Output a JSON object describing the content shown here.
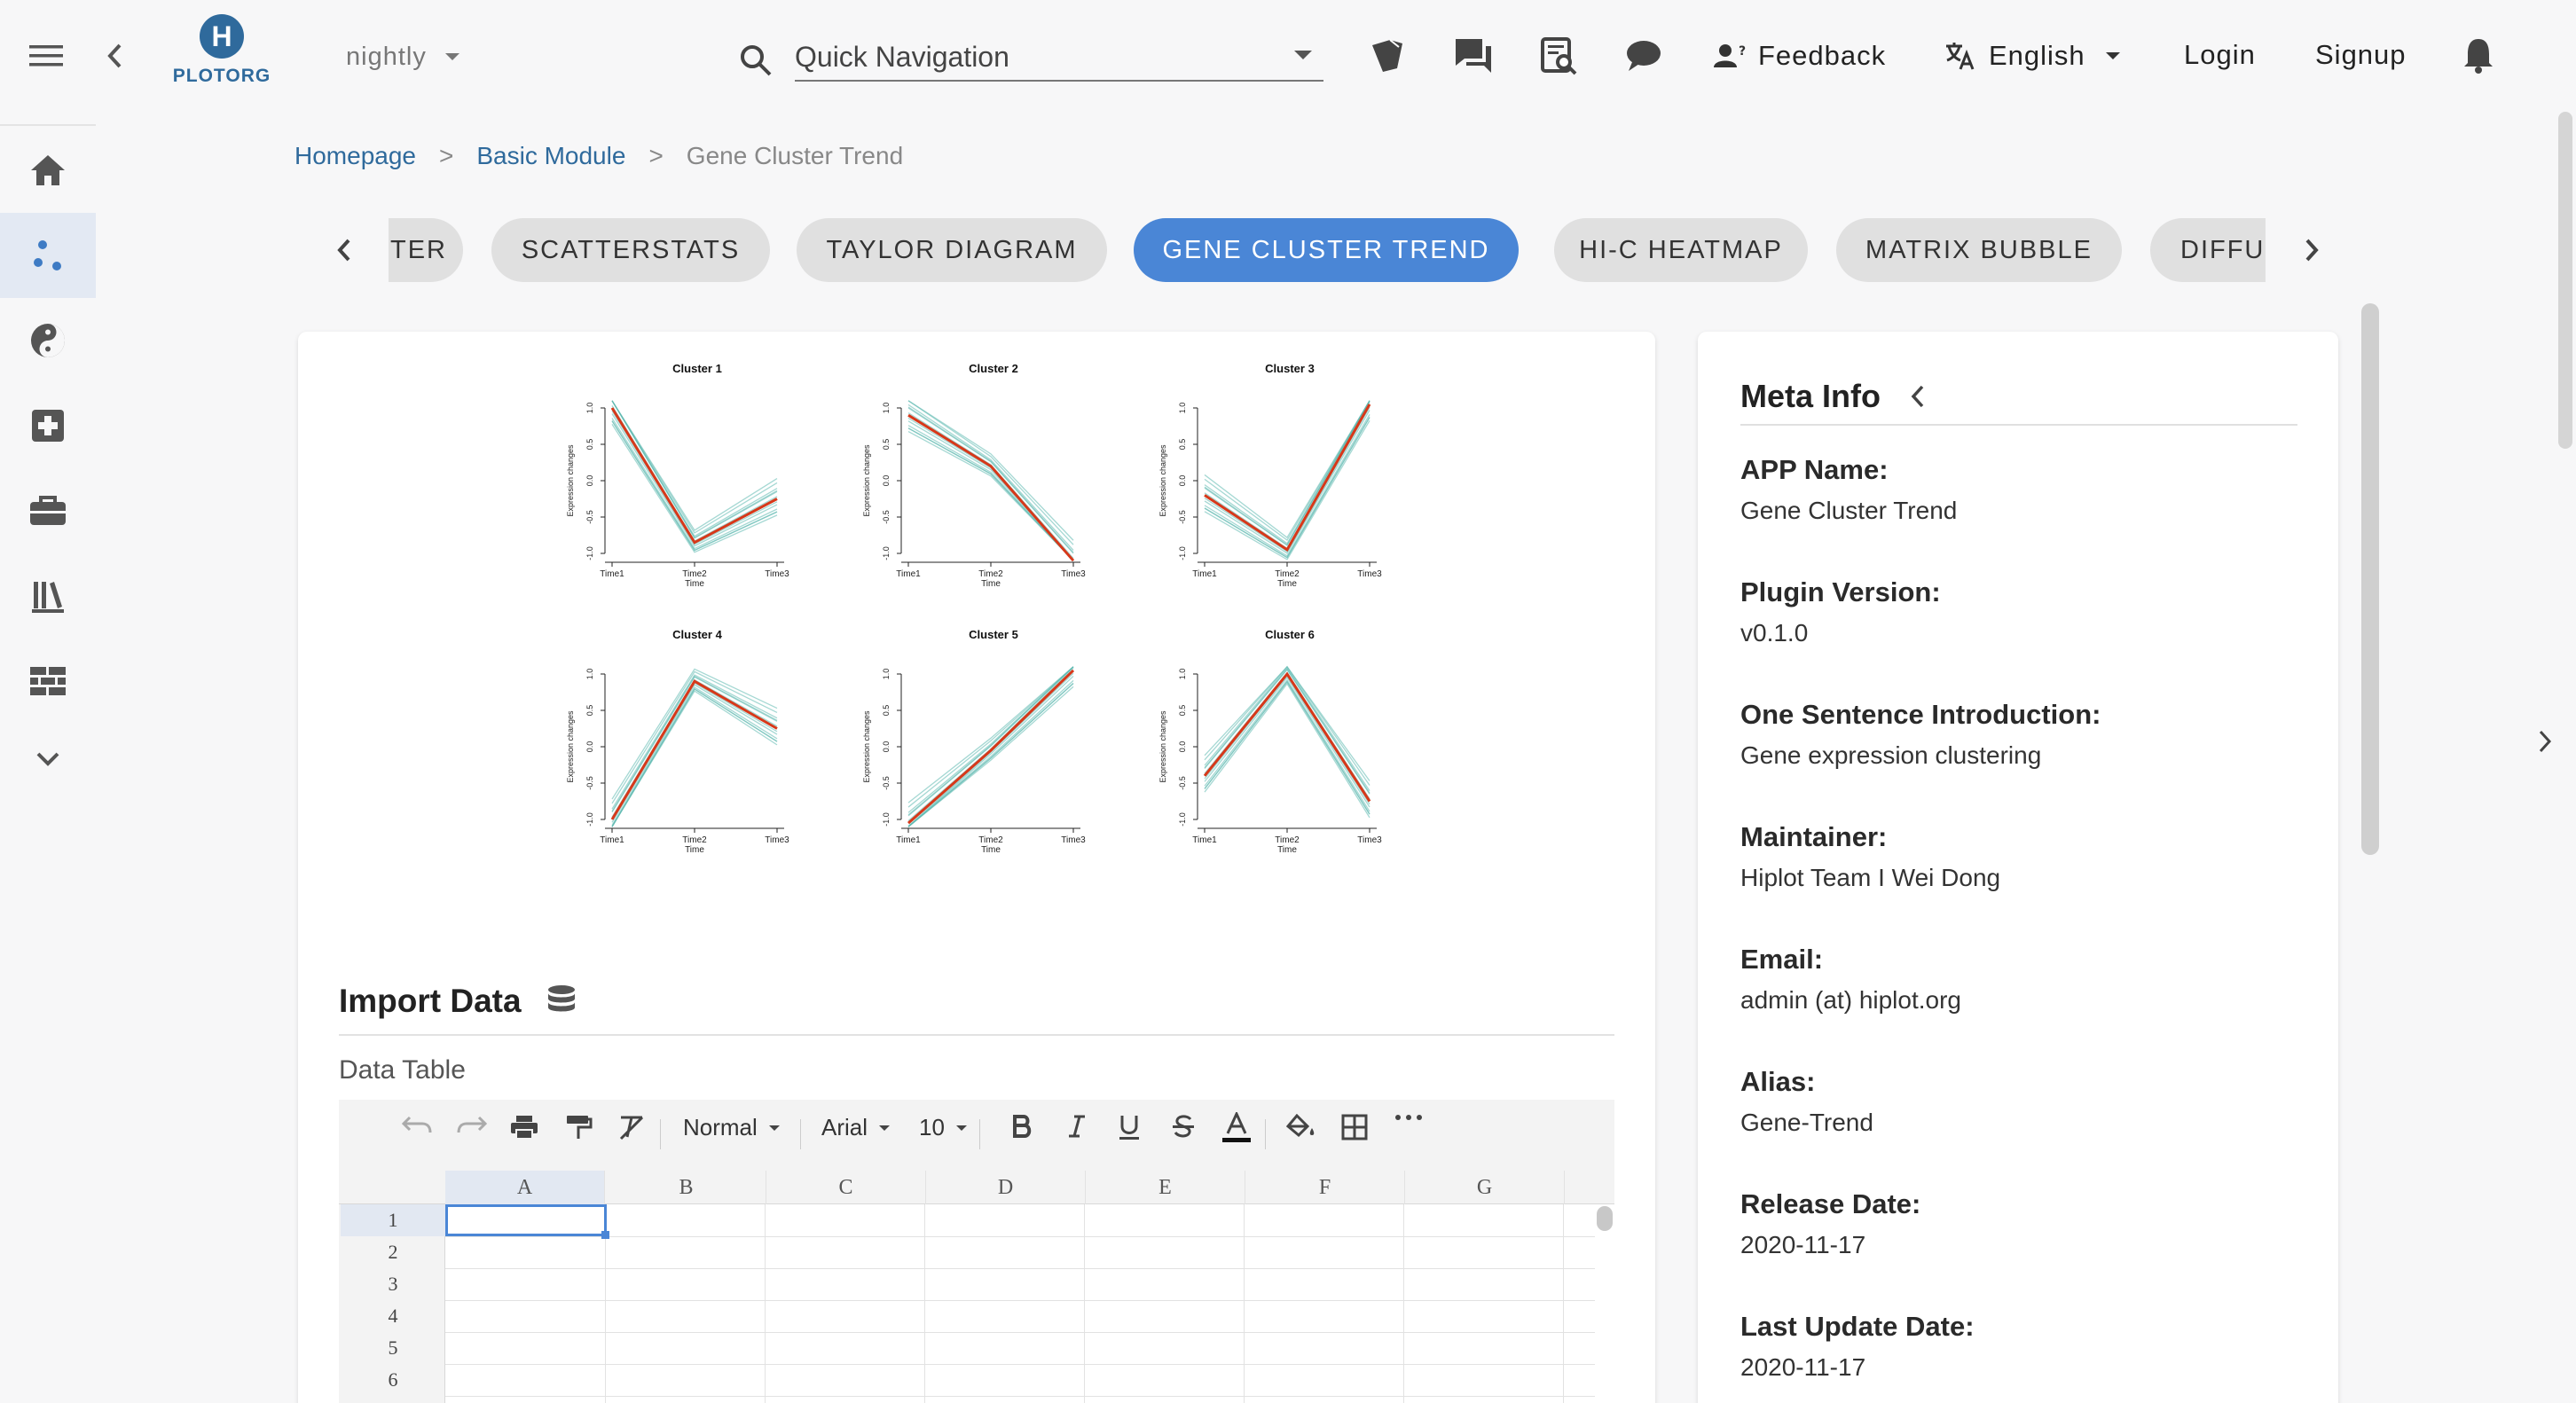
{
  "header": {
    "logo_letter": "H",
    "logo_text": "PLOTORG",
    "version_select": "nightly",
    "search_placeholder": "Quick Navigation",
    "feedback": "Feedback",
    "language": "English",
    "login": "Login",
    "signup": "Signup"
  },
  "breadcrumb": {
    "home": "Homepage",
    "sep1": ">",
    "module": "Basic Module",
    "sep2": ">",
    "current": "Gene Cluster Trend"
  },
  "chips": [
    "TER",
    "SCATTERSTATS",
    "TAYLOR DIAGRAM",
    "GENE CLUSTER TREND",
    "HI-C HEATMAP",
    "MATRIX BUBBLE",
    "DIFFU"
  ],
  "preview": {
    "clusters": [
      "Cluster 1",
      "Cluster 2",
      "Cluster 3",
      "Cluster 4",
      "Cluster 5",
      "Cluster 6"
    ],
    "y_axis_label": "Expression changes",
    "x_axis_label": "Time",
    "x_ticks": [
      "Time1",
      "Time2",
      "Time3"
    ],
    "y_ticks": [
      "1.0",
      "0.5",
      "0.0",
      "-0.5",
      "-1.0"
    ]
  },
  "chart_data": [
    {
      "type": "line",
      "title": "Cluster 1",
      "x": [
        "Time1",
        "Time2",
        "Time3"
      ],
      "series": [
        {
          "values": [
            1.0,
            -0.85,
            -0.25
          ]
        }
      ],
      "xlabel": "Time",
      "ylabel": "Expression changes",
      "ylim": [
        -1.0,
        1.0
      ]
    },
    {
      "type": "line",
      "title": "Cluster 2",
      "x": [
        "Time1",
        "Time2",
        "Time3"
      ],
      "series": [
        {
          "values": [
            0.9,
            0.2,
            -1.1
          ]
        }
      ],
      "xlabel": "Time",
      "ylabel": "Expression changes",
      "ylim": [
        -1.0,
        1.0
      ]
    },
    {
      "type": "line",
      "title": "Cluster 3",
      "x": [
        "Time1",
        "Time2",
        "Time3"
      ],
      "series": [
        {
          "values": [
            -0.2,
            -0.95,
            1.05
          ]
        }
      ],
      "xlabel": "Time",
      "ylabel": "Expression changes",
      "ylim": [
        -1.0,
        1.0
      ]
    },
    {
      "type": "line",
      "title": "Cluster 4",
      "x": [
        "Time1",
        "Time2",
        "Time3"
      ],
      "series": [
        {
          "values": [
            -1.0,
            0.9,
            0.25
          ]
        }
      ],
      "xlabel": "Time",
      "ylabel": "Expression changes",
      "ylim": [
        -1.0,
        1.0
      ]
    },
    {
      "type": "line",
      "title": "Cluster 5",
      "x": [
        "Time1",
        "Time2",
        "Time3"
      ],
      "series": [
        {
          "values": [
            -1.05,
            -0.05,
            1.05
          ]
        }
      ],
      "xlabel": "Time",
      "ylabel": "Expression changes",
      "ylim": [
        -1.0,
        1.0
      ]
    },
    {
      "type": "line",
      "title": "Cluster 6",
      "x": [
        "Time1",
        "Time2",
        "Time3"
      ],
      "series": [
        {
          "values": [
            -0.4,
            1.0,
            -0.75
          ]
        }
      ],
      "xlabel": "Time",
      "ylabel": "Expression changes",
      "ylim": [
        -1.0,
        1.0
      ]
    }
  ],
  "import": {
    "title": "Import Data",
    "table_label": "Data Table"
  },
  "sheet": {
    "style": "Normal",
    "font": "Arial",
    "size": "10",
    "columns": [
      "A",
      "B",
      "C",
      "D",
      "E",
      "F",
      "G"
    ],
    "rows": [
      "1",
      "2",
      "3",
      "4",
      "5",
      "6"
    ]
  },
  "meta": {
    "title": "Meta Info",
    "fields": [
      {
        "label": "APP Name:",
        "value": "Gene Cluster Trend"
      },
      {
        "label": "Plugin Version:",
        "value": "v0.1.0"
      },
      {
        "label": "One Sentence Introduction:",
        "value": "Gene expression clustering"
      },
      {
        "label": "Maintainer:",
        "value": "Hiplot Team I Wei Dong"
      },
      {
        "label": "Email:",
        "value": "admin (at) hiplot.org"
      },
      {
        "label": "Alias:",
        "value": "Gene-Trend"
      },
      {
        "label": "Release Date:",
        "value": "2020-11-17"
      },
      {
        "label": "Last Update Date:",
        "value": "2020-11-17"
      }
    ]
  },
  "colors": {
    "accent": "#4a86d6",
    "logo": "#2f6a9c",
    "trend_line": "#d7381a",
    "member_line": "#5bb8ae"
  }
}
